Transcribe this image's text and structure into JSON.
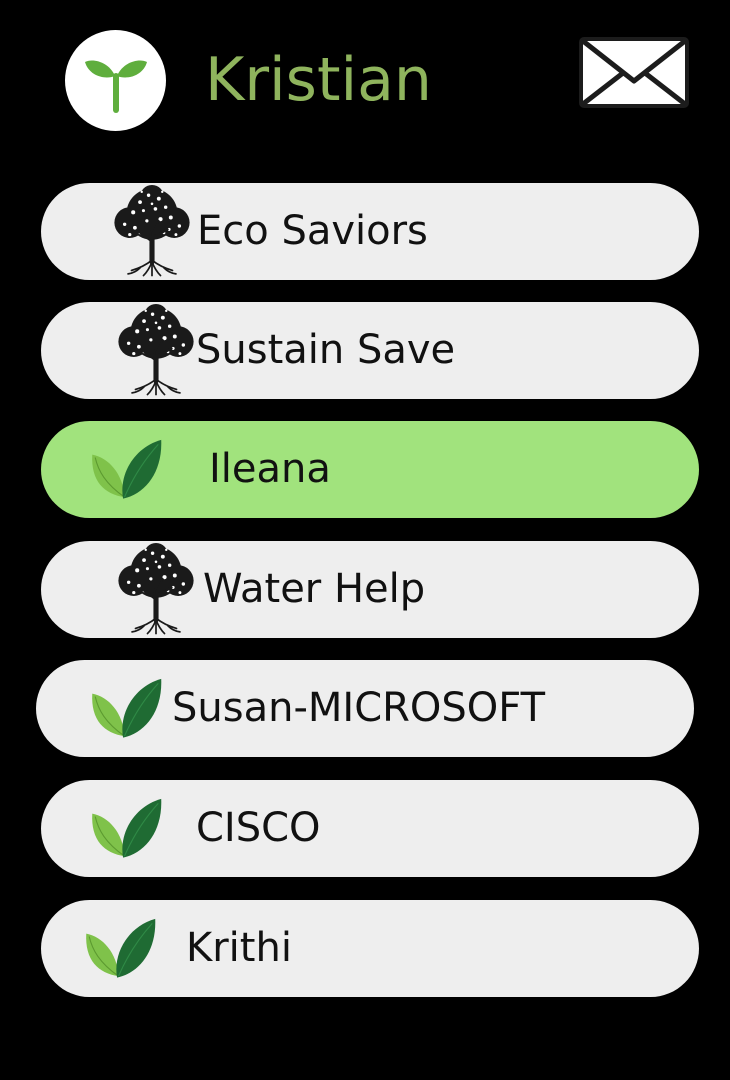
{
  "header": {
    "user_name": "Kristian",
    "avatar_icon": "sprout-icon",
    "mail_icon": "envelope-icon",
    "name_color": "#8fb45d"
  },
  "contacts": [
    {
      "name": "Eco Saviors",
      "icon": "tree-icon",
      "active": false
    },
    {
      "name": "Sustain Save",
      "icon": "tree-icon",
      "active": false
    },
    {
      "name": "Ileana",
      "icon": "leaves-icon",
      "active": true
    },
    {
      "name": "Water Help",
      "icon": "tree-icon",
      "active": false
    },
    {
      "name": "Susan-MICROSOFT",
      "icon": "leaves-icon",
      "active": false
    },
    {
      "name": "CISCO",
      "icon": "leaves-icon",
      "active": false
    },
    {
      "name": "Krithi",
      "icon": "leaves-icon",
      "active": false
    }
  ],
  "colors": {
    "background": "#000000",
    "pill": "#eeeeee",
    "pill_active": "#a1e37d",
    "leaf_light": "#7fc24a",
    "leaf_dark": "#1f6b33"
  }
}
